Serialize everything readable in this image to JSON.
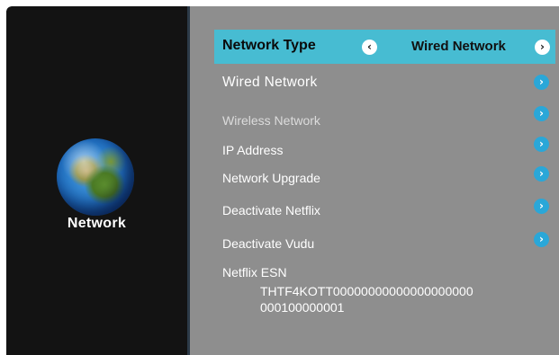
{
  "sidebar": {
    "title": "Network",
    "icon": "globe-icon"
  },
  "header": {
    "title": "Network Type",
    "value": "Wired Network",
    "left_arrow": "‹",
    "right_arrow": "›"
  },
  "menu": {
    "items": [
      {
        "label": "Wired Network"
      },
      {
        "label": "Wireless Network"
      },
      {
        "label": "IP Address"
      },
      {
        "label": "Network Upgrade"
      },
      {
        "label": "Deactivate Netflix"
      },
      {
        "label": "Deactivate Vudu"
      }
    ],
    "arrow": "›"
  },
  "esn": {
    "label": "Netflix ESN",
    "line1": "THTF4KOTT00000000000000000000",
    "line2": "000100000001"
  },
  "colors": {
    "highlight": "#47bcd2",
    "panel": "#8e8e8e",
    "sidebar": "#131313",
    "arrow": "#2aa7d8"
  }
}
